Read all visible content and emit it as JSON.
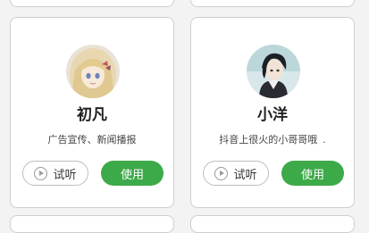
{
  "colors": {
    "accent": "#3daa49",
    "card_border": "#cfcfcf",
    "background": "#f3f3f3"
  },
  "voices": [
    {
      "name": "初凡",
      "description": "广告宣传、新闻播报",
      "listen_label": "试听",
      "use_label": "使用",
      "avatar_icon": "anime-girl-avatar"
    },
    {
      "name": "小洋",
      "description": "抖音上很火的小哥哥哦",
      "description_suffix": ".",
      "listen_label": "试听",
      "use_label": "使用",
      "avatar_icon": "anime-boy-avatar"
    }
  ]
}
